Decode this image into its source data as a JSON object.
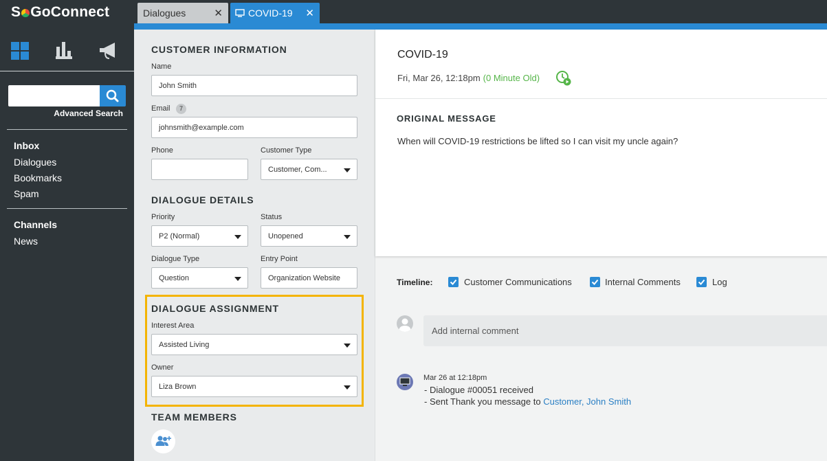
{
  "app": {
    "logo_text_pre": "S",
    "logo_text_post": "GoConnect"
  },
  "sidebar": {
    "nav_icons": [
      "dashboard-icon",
      "reports-icon",
      "announcements-icon"
    ],
    "search_placeholder": "",
    "advanced_search": "Advanced Search",
    "sections": [
      {
        "heading": "Inbox",
        "items": [
          "Dialogues",
          "Bookmarks",
          "Spam"
        ]
      },
      {
        "heading": "Channels",
        "items": [
          "News"
        ]
      }
    ]
  },
  "tabs": [
    {
      "label": "Dialogues",
      "active": false
    },
    {
      "label": "COVID-19",
      "active": true
    }
  ],
  "form": {
    "customer_info": {
      "title": "CUSTOMER INFORMATION",
      "name_label": "Name",
      "name_value": "John Smith",
      "email_label": "Email",
      "email_badge": "7",
      "email_value": "johnsmith@example.com",
      "phone_label": "Phone",
      "phone_value": "",
      "customer_type_label": "Customer Type",
      "customer_type_value": "Customer, Com..."
    },
    "dialogue_details": {
      "title": "DIALOGUE DETAILS",
      "priority_label": "Priority",
      "priority_value": "P2 (Normal)",
      "status_label": "Status",
      "status_value": "Unopened",
      "dialogue_type_label": "Dialogue Type",
      "dialogue_type_value": "Question",
      "entry_point_label": "Entry Point",
      "entry_point_value": "Organization Website"
    },
    "dialogue_assignment": {
      "title": "DIALOGUE ASSIGNMENT",
      "interest_area_label": "Interest Area",
      "interest_area_value": "Assisted Living",
      "owner_label": "Owner",
      "owner_value": "Liza Brown"
    },
    "team_members": {
      "title": "TEAM MEMBERS"
    }
  },
  "message": {
    "title": "COVID-19",
    "date": "Fri, Mar 26, 12:18pm",
    "age": "(0 Minute Old)",
    "original_title": "ORIGINAL MESSAGE",
    "original_body": "When will COVID-19 restrictions be lifted so I can visit my uncle again?"
  },
  "timeline": {
    "label": "Timeline:",
    "filters": [
      {
        "label": "Customer Communications",
        "checked": true
      },
      {
        "label": "Internal Comments",
        "checked": true
      },
      {
        "label": "Log",
        "checked": true
      }
    ],
    "comment_placeholder": "Add internal comment",
    "event": {
      "time": "Mar 26 at 12:18pm",
      "line1": "-  Dialogue #00051 received",
      "line2_prefix": "-  Sent Thank you message to ",
      "line2_link": "Customer, John Smith"
    }
  },
  "colors": {
    "accent_blue": "#2a8ad4",
    "sidebar_bg": "#2e3539",
    "highlight": "#f4b400",
    "age_green": "#55b548"
  }
}
